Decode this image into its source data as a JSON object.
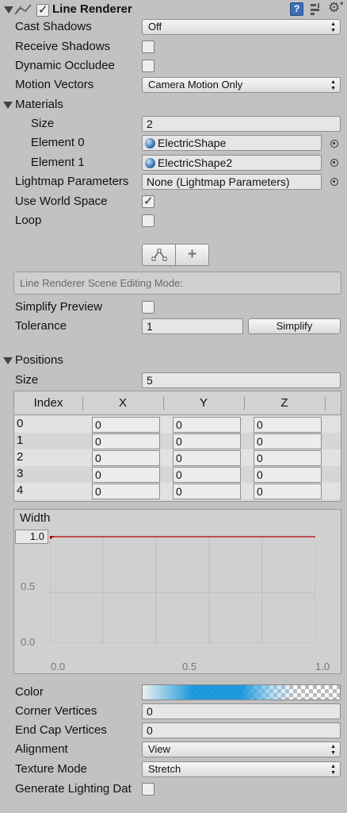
{
  "header": {
    "title": "Line Renderer",
    "enabled": true
  },
  "props": {
    "cast_shadows": {
      "label": "Cast Shadows",
      "value": "Off"
    },
    "receive_shadows": {
      "label": "Receive Shadows",
      "checked": false
    },
    "dynamic_occludee": {
      "label": "Dynamic Occludee",
      "checked": false
    },
    "motion_vectors": {
      "label": "Motion Vectors",
      "value": "Camera Motion Only"
    }
  },
  "materials": {
    "label": "Materials",
    "size_label": "Size",
    "size": "2",
    "elements": [
      {
        "label": "Element 0",
        "value": "ElectricShape"
      },
      {
        "label": "Element 1",
        "value": "ElectricShape2"
      }
    ]
  },
  "lightmap": {
    "label": "Lightmap Parameters",
    "value": "None (Lightmap Parameters)"
  },
  "use_world_space": {
    "label": "Use World Space",
    "checked": true
  },
  "loop": {
    "label": "Loop",
    "checked": false
  },
  "editing": {
    "plus_label": "+",
    "mode_label": "Line Renderer Scene Editing Mode:"
  },
  "simplify_preview": {
    "label": "Simplify Preview",
    "checked": false
  },
  "tolerance": {
    "label": "Tolerance",
    "value": "1",
    "button": "Simplify"
  },
  "positions": {
    "label": "Positions",
    "size_label": "Size",
    "size": "5",
    "columns": [
      "Index",
      "X",
      "Y",
      "Z"
    ],
    "rows": [
      {
        "index": "0",
        "x": "0",
        "y": "0",
        "z": "0"
      },
      {
        "index": "1",
        "x": "0",
        "y": "0",
        "z": "0"
      },
      {
        "index": "2",
        "x": "0",
        "y": "0",
        "z": "0"
      },
      {
        "index": "3",
        "x": "0",
        "y": "0",
        "z": "0"
      },
      {
        "index": "4",
        "x": "0",
        "y": "0",
        "z": "0"
      }
    ]
  },
  "width_curve": {
    "label": "Width",
    "value_label": "1.0",
    "y_ticks": [
      "0.5",
      "0.0"
    ],
    "x_ticks": [
      "0.0",
      "0.5",
      "1.0"
    ],
    "curve_color": "#b00000"
  },
  "color": {
    "label": "Color",
    "accent": "#1496dc"
  },
  "corner_vertices": {
    "label": "Corner Vertices",
    "value": "0"
  },
  "end_cap_vertices": {
    "label": "End Cap Vertices",
    "value": "0"
  },
  "alignment": {
    "label": "Alignment",
    "value": "View"
  },
  "texture_mode": {
    "label": "Texture Mode",
    "value": "Stretch"
  },
  "generate_lighting": {
    "label": "Generate Lighting Dat",
    "checked": false
  }
}
